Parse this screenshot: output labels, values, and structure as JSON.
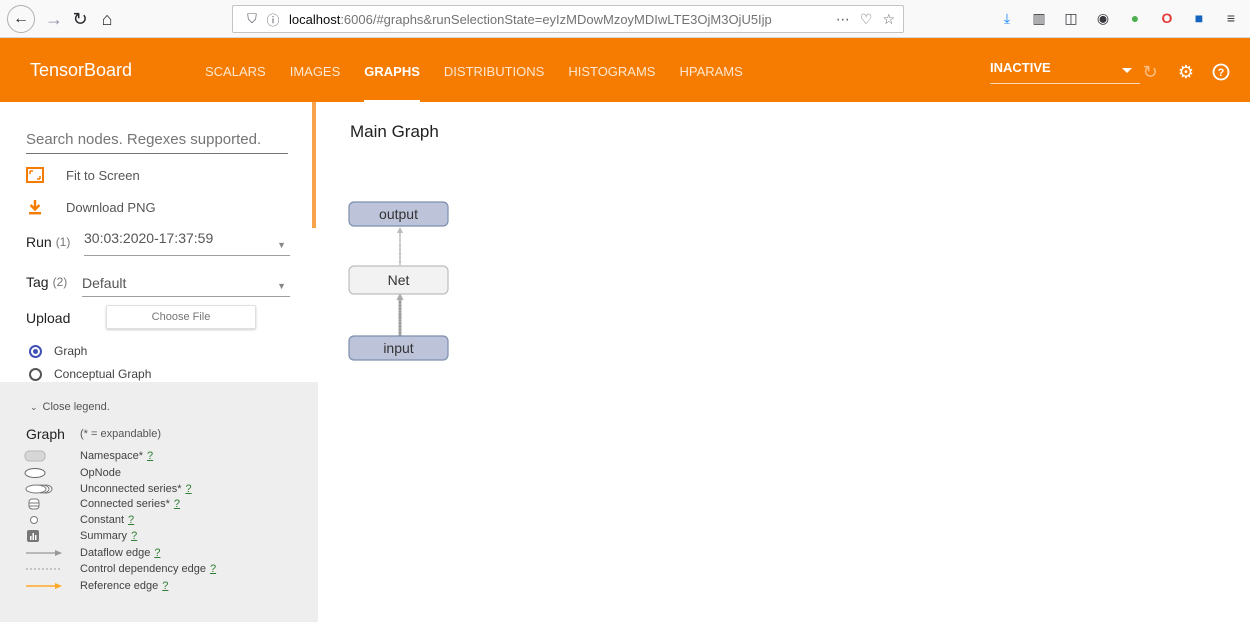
{
  "browser": {
    "url_host": "localhost",
    "url_rest": ":6006/#graphs&runSelectionState=eyIzMDowMzoyMDIwLTE3OjM3OjU5Ijp",
    "more_icon": "⋯"
  },
  "header": {
    "title": "TensorBoard",
    "tabs": [
      {
        "label": "SCALARS"
      },
      {
        "label": "IMAGES"
      },
      {
        "label": "GRAPHS"
      },
      {
        "label": "DISTRIBUTIONS"
      },
      {
        "label": "HISTOGRAMS"
      },
      {
        "label": "HPARAMS"
      }
    ],
    "active_tab": "GRAPHS",
    "status_select": "INACTIVE",
    "accent_color": "#f57c00"
  },
  "sidebar": {
    "search_placeholder": "Search nodes. Regexes supported.",
    "fit_to_screen": "Fit to Screen",
    "download_png": "Download PNG",
    "run_label": "Run",
    "run_count": "(1)",
    "run_value": "30:03:2020-17:37:59",
    "tag_label": "Tag",
    "tag_count": "(2)",
    "tag_value": "Default",
    "upload_label": "Upload",
    "choose_file": "Choose File",
    "radio_graph": "Graph",
    "radio_conceptual": "Conceptual Graph",
    "selected_radio": "Graph"
  },
  "legend": {
    "toggle": "Close legend.",
    "title": "Graph",
    "note": "(* = expandable)",
    "help": "?",
    "items": [
      {
        "label": "Namespace*",
        "icon": "namespace-icon"
      },
      {
        "label": "OpNode",
        "icon": "opnode-icon"
      },
      {
        "label": "Unconnected series*",
        "icon": "unconnected-series-icon"
      },
      {
        "label": "Connected series*",
        "icon": "connected-series-icon"
      },
      {
        "label": "Constant",
        "icon": "constant-icon"
      },
      {
        "label": "Summary",
        "icon": "summary-icon"
      },
      {
        "label": "Dataflow edge",
        "icon": "dataflow-edge-icon"
      },
      {
        "label": "Control dependency edge",
        "icon": "control-edge-icon"
      },
      {
        "label": "Reference edge",
        "icon": "reference-edge-icon"
      }
    ]
  },
  "main": {
    "title": "Main Graph",
    "nodes": [
      {
        "label": "output"
      },
      {
        "label": "Net"
      },
      {
        "label": "input"
      }
    ]
  }
}
